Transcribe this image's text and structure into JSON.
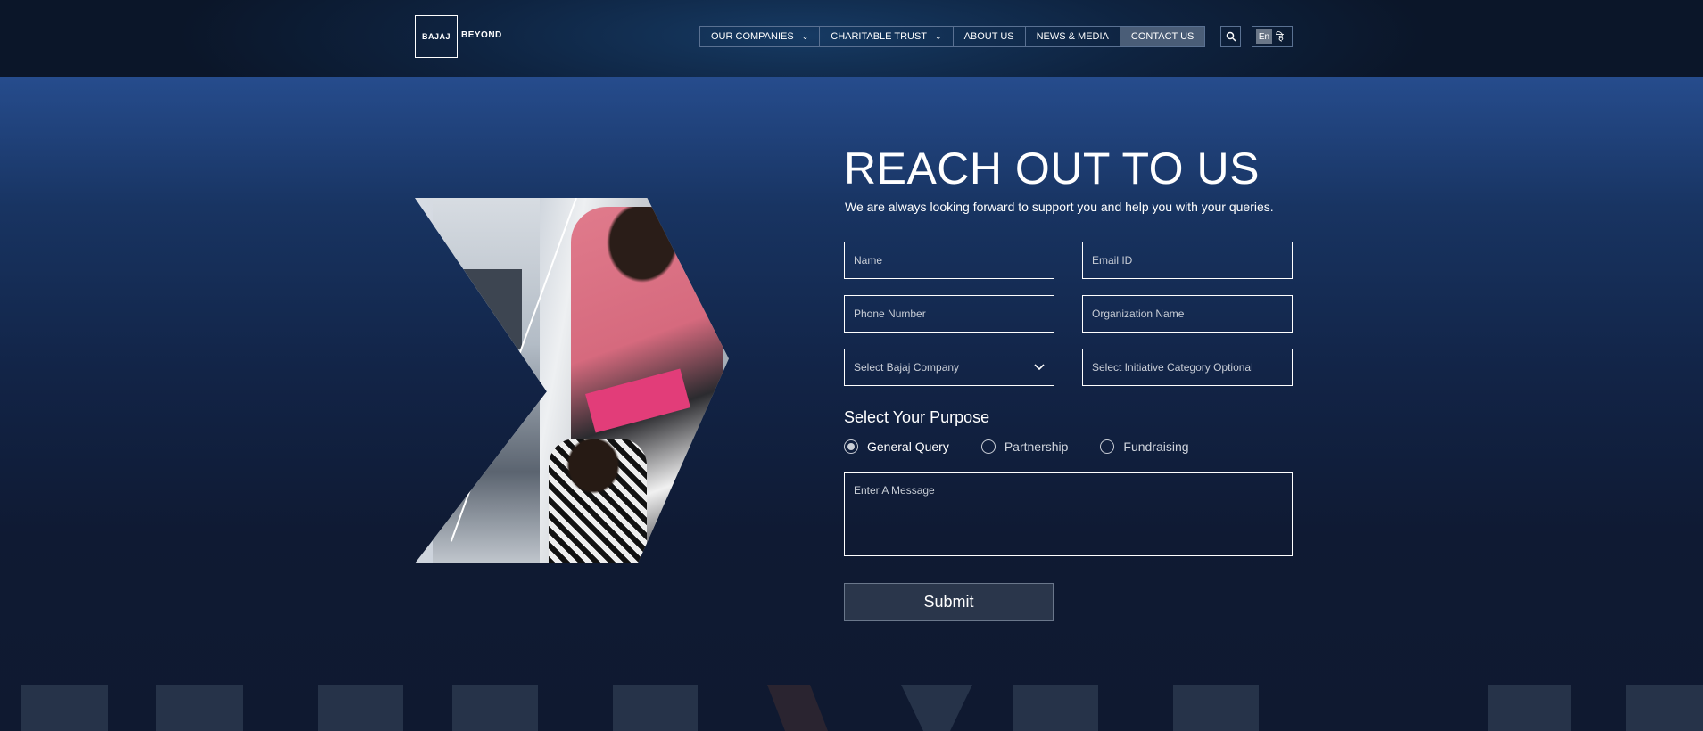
{
  "header": {
    "logo_text": "BAJAJ",
    "logo_suffix": "BEYOND",
    "nav": [
      {
        "label": "OUR COMPANIES",
        "dropdown": true
      },
      {
        "label": "CHARITABLE TRUST",
        "dropdown": true
      },
      {
        "label": "ABOUT US",
        "dropdown": false
      },
      {
        "label": "NEWS & MEDIA",
        "dropdown": false
      },
      {
        "label": "CONTACT US",
        "dropdown": false,
        "active": true
      }
    ],
    "search_icon": "search-icon",
    "lang_en": "En",
    "lang_hi": "हि"
  },
  "contact": {
    "title": "REACH OUT TO US",
    "subtitle": "We are always looking forward to support you and help you with your queries.",
    "fields": {
      "name": "Name",
      "email": "Email ID",
      "phone": "Phone Number",
      "org": "Organization Name",
      "company_select": "Select Bajaj Company",
      "category": "Select Initiative Category Optional"
    },
    "purpose_title": "Select Your Purpose",
    "purposes": [
      {
        "label": "General Query",
        "selected": true
      },
      {
        "label": "Partnership",
        "selected": false
      },
      {
        "label": "Fundraising",
        "selected": false
      }
    ],
    "message_placeholder": "Enter A Message",
    "submit_label": "Submit"
  },
  "colors": {
    "header_bg": "#0e2340",
    "accent_top": "#264c8d",
    "page_bg": "#0f1930",
    "active_nav": "#4a5d77",
    "submit_bg": "#2a364b"
  }
}
